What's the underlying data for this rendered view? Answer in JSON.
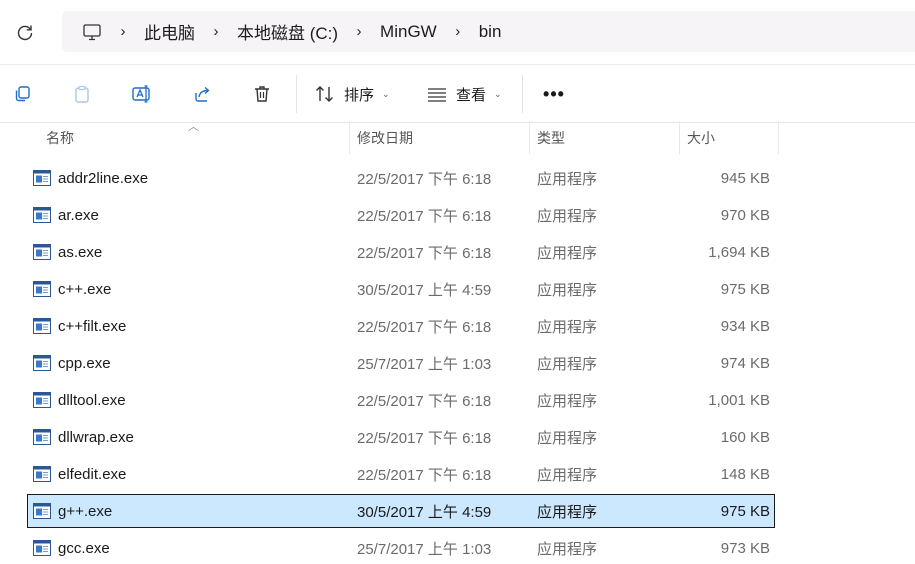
{
  "breadcrumb": {
    "items": [
      "此电脑",
      "本地磁盘 (C:)",
      "MinGW",
      "bin"
    ]
  },
  "toolbar": {
    "sort_label": "排序",
    "view_label": "查看",
    "more_label": "•••"
  },
  "columns": {
    "name": "名称",
    "date": "修改日期",
    "type": "类型",
    "size": "大小"
  },
  "files": [
    {
      "name": "addr2line.exe",
      "date": "22/5/2017 下午 6:18",
      "type": "应用程序",
      "size": "945 KB"
    },
    {
      "name": "ar.exe",
      "date": "22/5/2017 下午 6:18",
      "type": "应用程序",
      "size": "970 KB"
    },
    {
      "name": "as.exe",
      "date": "22/5/2017 下午 6:18",
      "type": "应用程序",
      "size": "1,694 KB"
    },
    {
      "name": "c++.exe",
      "date": "30/5/2017 上午 4:59",
      "type": "应用程序",
      "size": "975 KB"
    },
    {
      "name": "c++filt.exe",
      "date": "22/5/2017 下午 6:18",
      "type": "应用程序",
      "size": "934 KB"
    },
    {
      "name": "cpp.exe",
      "date": "25/7/2017 上午 1:03",
      "type": "应用程序",
      "size": "974 KB"
    },
    {
      "name": "dlltool.exe",
      "date": "22/5/2017 下午 6:18",
      "type": "应用程序",
      "size": "1,001 KB"
    },
    {
      "name": "dllwrap.exe",
      "date": "22/5/2017 下午 6:18",
      "type": "应用程序",
      "size": "160 KB"
    },
    {
      "name": "elfedit.exe",
      "date": "22/5/2017 下午 6:18",
      "type": "应用程序",
      "size": "148 KB"
    },
    {
      "name": "g++.exe",
      "date": "30/5/2017 上午 4:59",
      "type": "应用程序",
      "size": "975 KB",
      "selected": true
    },
    {
      "name": "gcc.exe",
      "date": "25/7/2017 上午 1:03",
      "type": "应用程序",
      "size": "973 KB"
    }
  ],
  "colors": {
    "selection": "#cce8ff",
    "breadcrumb_bg": "#f7f4f8"
  }
}
